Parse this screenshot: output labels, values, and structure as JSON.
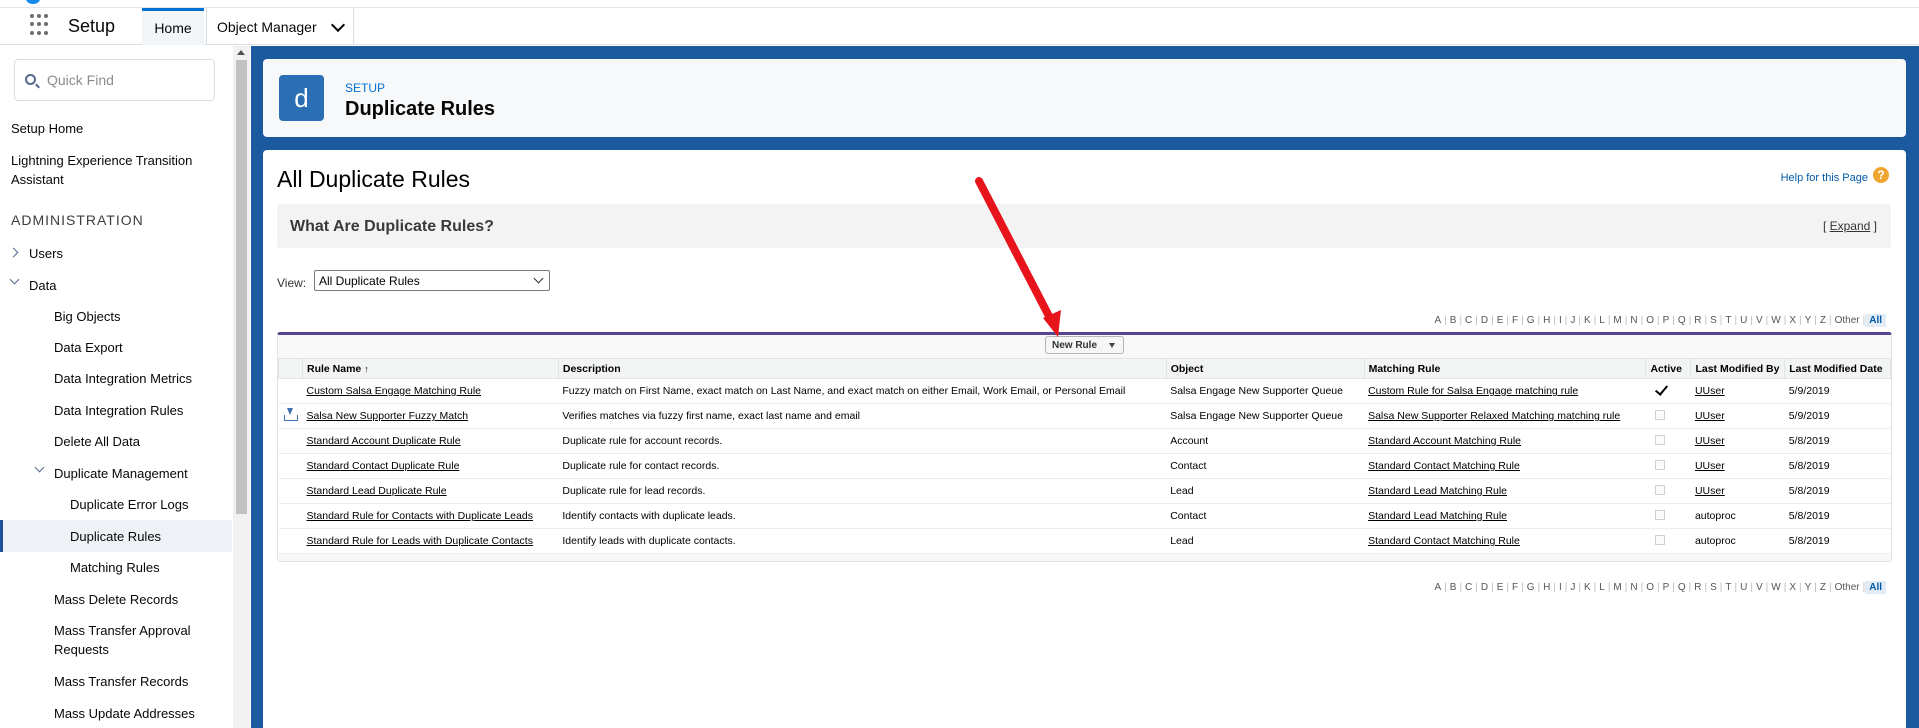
{
  "app": {
    "name": "Setup"
  },
  "tabs": [
    {
      "label": "Home"
    },
    {
      "label": "Object Manager"
    }
  ],
  "sidebar": {
    "quick_find_placeholder": "Quick Find",
    "setup_home": "Setup Home",
    "lightning_transition_line1": "Lightning Experience Transition",
    "lightning_transition_line2": "Assistant",
    "section_administration": "ADMINISTRATION",
    "users": "Users",
    "data": "Data",
    "data_items": [
      "Big Objects",
      "Data Export",
      "Data Integration Metrics",
      "Data Integration Rules",
      "Delete All Data"
    ],
    "duplicate_management": "Duplicate Management",
    "dup_items": [
      "Duplicate Error Logs",
      "Duplicate Rules",
      "Matching Rules"
    ],
    "more_items": [
      "Mass Delete Records",
      "Mass Transfer Approval",
      "Requests",
      "Mass Transfer Records",
      "Mass Update Addresses"
    ]
  },
  "header": {
    "icon_letter": "d",
    "breadcrumb": "SETUP",
    "title": "Duplicate Rules"
  },
  "content": {
    "heading": "All Duplicate Rules",
    "help_link": "Help for this Page",
    "help_icon_text": "?",
    "what_title": "What Are Duplicate Rules?",
    "expand_open": "[ ",
    "expand_label": "Expand",
    "expand_close": " ]",
    "view_label": "View:",
    "view_value": "All Duplicate Rules",
    "new_rule_label": "New Rule",
    "alphabet": [
      "A",
      "B",
      "C",
      "D",
      "E",
      "F",
      "G",
      "H",
      "I",
      "J",
      "K",
      "L",
      "M",
      "N",
      "O",
      "P",
      "Q",
      "R",
      "S",
      "T",
      "U",
      "V",
      "W",
      "X",
      "Y",
      "Z",
      "Other",
      "All"
    ]
  },
  "table": {
    "columns": [
      "Rule Name",
      "Description",
      "Object",
      "Matching Rule",
      "Active",
      "Last Modified By",
      "Last Modified Date"
    ],
    "sort_glyph": "↑",
    "rows": [
      {
        "name": "Custom Salsa Engage Matching Rule",
        "description": "Fuzzy match on First Name, exact match on Last Name, and exact match on either Email, Work Email, or Personal Email",
        "object": "Salsa Engage New Supporter Queue",
        "matching_rule": "Custom Rule for Salsa Engage matching rule",
        "active": true,
        "modified_by": "UUser",
        "modified_by_link": true,
        "date": "5/9/2019"
      },
      {
        "name": "Salsa New Supporter Fuzzy Match",
        "description": "Verifies matches via fuzzy first name, exact last name and email",
        "object": "Salsa Engage New Supporter Queue",
        "matching_rule": "Salsa New Supporter Relaxed Matching matching rule",
        "active": false,
        "modified_by": "UUser",
        "modified_by_link": true,
        "date": "5/9/2019"
      },
      {
        "name": "Standard Account Duplicate Rule",
        "description": "Duplicate rule for account records.",
        "object": "Account",
        "matching_rule": "Standard Account Matching Rule",
        "active": false,
        "modified_by": "UUser",
        "modified_by_link": true,
        "date": "5/8/2019"
      },
      {
        "name": "Standard Contact Duplicate Rule",
        "description": "Duplicate rule for contact records.",
        "object": "Contact",
        "matching_rule": "Standard Contact Matching Rule",
        "active": false,
        "modified_by": "UUser",
        "modified_by_link": true,
        "date": "5/8/2019"
      },
      {
        "name": "Standard Lead Duplicate Rule",
        "description": "Duplicate rule for lead records.",
        "object": "Lead",
        "matching_rule": "Standard Lead Matching Rule",
        "active": false,
        "modified_by": "UUser",
        "modified_by_link": true,
        "date": "5/8/2019"
      },
      {
        "name": "Standard Rule for Contacts with Duplicate Leads",
        "description": "Identify contacts with duplicate leads.",
        "object": "Contact",
        "matching_rule": "Standard Lead Matching Rule",
        "active": false,
        "modified_by": "autoproc",
        "modified_by_link": false,
        "date": "5/8/2019"
      },
      {
        "name": "Standard Rule for Leads with Duplicate Contacts",
        "description": "Identify leads with duplicate contacts.",
        "object": "Lead",
        "matching_rule": "Standard Contact Matching Rule",
        "active": false,
        "modified_by": "autoproc",
        "modified_by_link": false,
        "date": "5/8/2019"
      }
    ]
  },
  "colors": {
    "brand_blue": "#1c5aa0",
    "link_blue": "#0070d2",
    "annotation_red": "#e8141b"
  }
}
